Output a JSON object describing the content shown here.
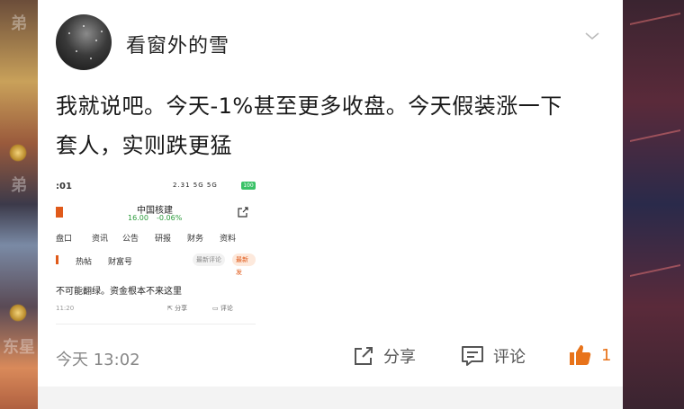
{
  "background": {
    "left_ghost_texts": [
      "弟",
      "弟",
      "东星"
    ],
    "accent": "#e05a1a"
  },
  "post": {
    "username": "看窗外的雪",
    "text_line1": "我就说吧。今天-1%甚至更多收盘。今天假装涨一下",
    "text_line2": "套人，实则跌更猛",
    "time": "今天 13:02",
    "actions": {
      "share_label": "分享",
      "comment_label": "评论",
      "like_count": "1"
    },
    "icons": {
      "more": "chevron-down-icon",
      "share": "share-icon",
      "comment": "comment-icon",
      "like": "thumbs-up-icon"
    }
  },
  "screenshot": {
    "status_time": ":01",
    "status_right": "2.31 5G 5G",
    "battery": "100",
    "stock_name": "中国核建",
    "stock_price": "16.00",
    "stock_change": "-0.06%",
    "tabs": [
      "盘口",
      "资讯",
      "公告",
      "研报",
      "财务",
      "资料"
    ],
    "subtabs": [
      "热帖",
      "财富号"
    ],
    "sort_options": [
      "最新评论",
      "最新发"
    ],
    "comment_text": "不可能翻绿。资金根本不来这里",
    "comment_time": "11:20",
    "comment_share": "分享",
    "comment_reply": "评论"
  }
}
